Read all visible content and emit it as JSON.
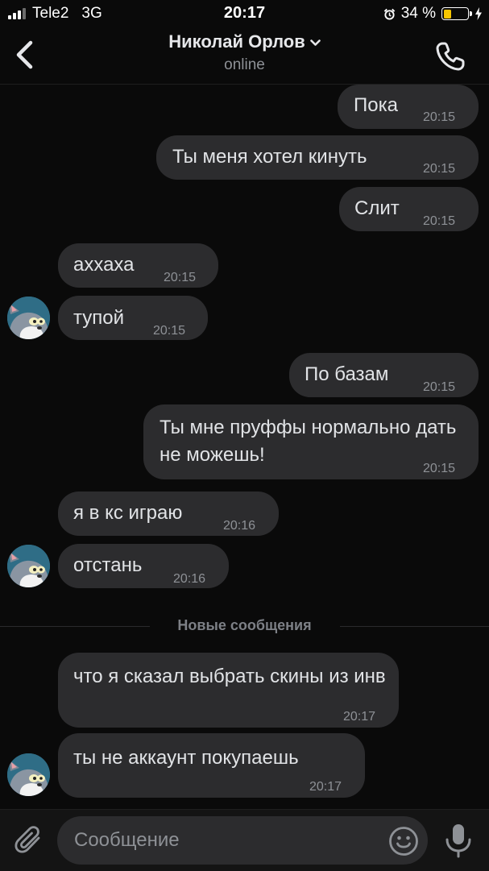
{
  "status_bar": {
    "carrier": "Tele2",
    "network": "3G",
    "time": "20:17",
    "battery_percent": "34 %",
    "battery_level": 0.34,
    "battery_color": "#f7c600",
    "icons": [
      "signal-icon",
      "alarm-icon",
      "battery-icon",
      "charging-icon"
    ]
  },
  "header": {
    "contact_name": "Николай Орлов",
    "status": "online",
    "icons": [
      "back-chevron-icon",
      "chevron-down-icon",
      "phone-icon"
    ]
  },
  "messages": [
    {
      "direction": "out",
      "text": "Пока",
      "time": "20:15"
    },
    {
      "direction": "out",
      "text": "Ты меня хотел кинуть",
      "time": "20:15"
    },
    {
      "direction": "out",
      "text": "Слит",
      "time": "20:15"
    },
    {
      "direction": "in",
      "text": "аххаха",
      "time": "20:15"
    },
    {
      "direction": "in",
      "text": "тупой",
      "time": "20:15"
    },
    {
      "direction": "out",
      "text": "По базам",
      "time": "20:15"
    },
    {
      "direction": "out",
      "text": "Ты мне пруффы нормально дать не можешь!",
      "time": "20:15"
    },
    {
      "direction": "in",
      "text": "я в кс играю",
      "time": "20:16"
    },
    {
      "direction": "in",
      "text": "отстань",
      "time": "20:16"
    },
    {
      "direction": "in",
      "text": "что я сказал выбрать скины из инв",
      "time": "20:17"
    },
    {
      "direction": "in",
      "text": "ты не аккаунт покупаешь",
      "time": "20:17"
    }
  ],
  "new_messages_divider": "Новые сообщения",
  "composer": {
    "placeholder": "Сообщение",
    "icons": [
      "paperclip-icon",
      "emoji-icon",
      "microphone-icon"
    ]
  },
  "colors": {
    "background": "#0a0a0a",
    "bubble": "#2c2c2e",
    "text": "#e1e3e6",
    "secondary_text": "#8e9196"
  }
}
